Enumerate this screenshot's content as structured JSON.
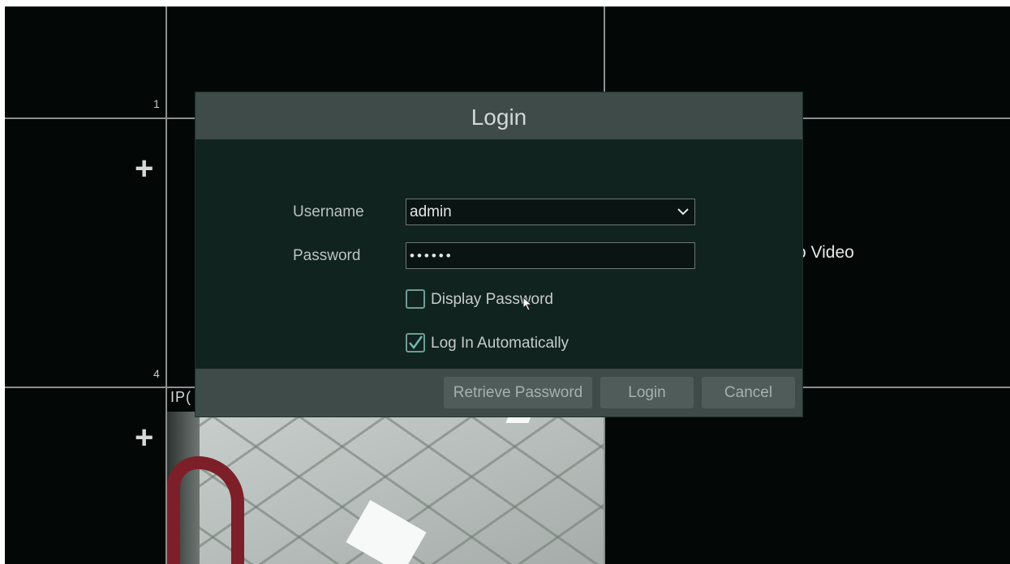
{
  "grid": {
    "channel_numbers": [
      "1",
      "4"
    ],
    "add_icon": "plus-icon",
    "no_video_text": "o Video",
    "ipc_label": "IP("
  },
  "dialog": {
    "title": "Login",
    "username_label": "Username",
    "username_value": "admin",
    "password_label": "Password",
    "password_value": "••••••",
    "display_password_label": "Display Password",
    "display_password_checked": false,
    "auto_login_label": "Log In Automatically",
    "auto_login_checked": true
  },
  "buttons": {
    "retrieve_password": "Retrieve Password",
    "login": "Login",
    "cancel": "Cancel"
  },
  "colors": {
    "dialog_bg": "#11231f",
    "header_bg": "#3f4b48",
    "checkbox_accent": "#6fb8b0"
  }
}
